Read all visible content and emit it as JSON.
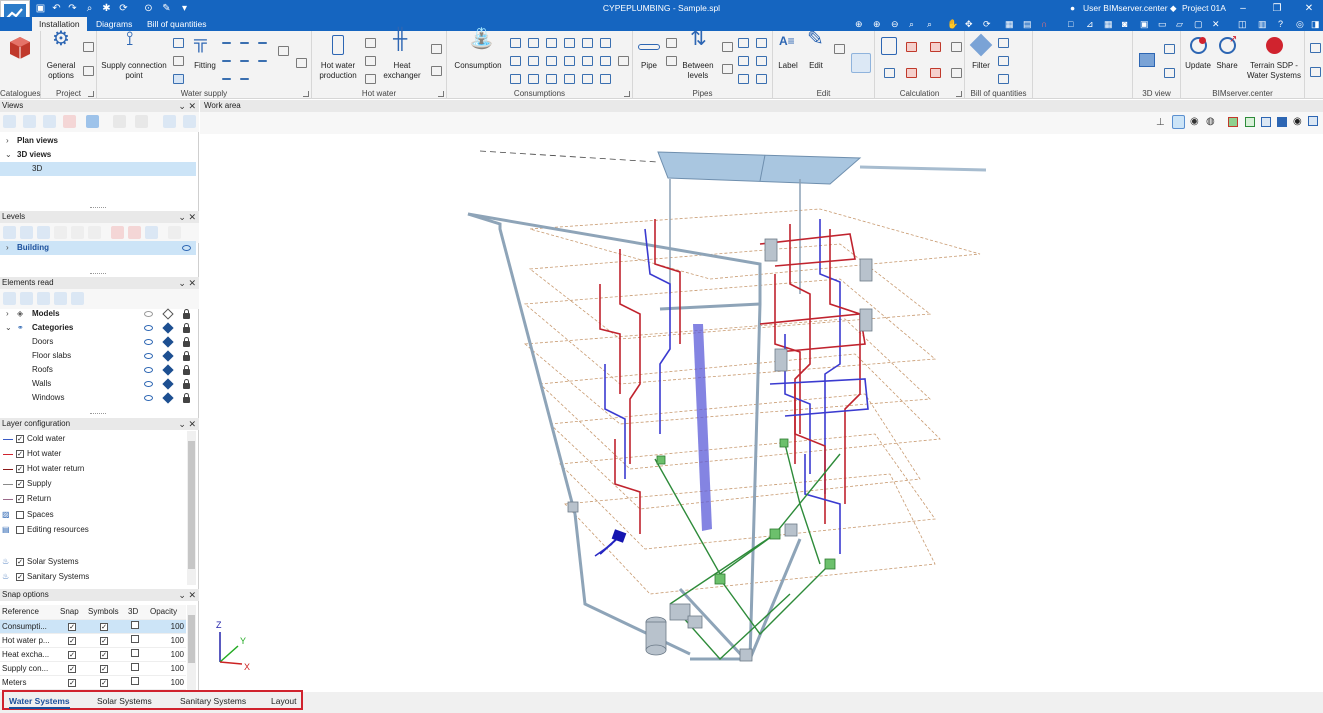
{
  "window": {
    "title": "CYPEPLUMBING - Sample.spl",
    "user": "User BIMserver.center",
    "project": "Project 01A"
  },
  "ribbon_tabs": [
    {
      "label": "Installation",
      "active": true
    },
    {
      "label": "Diagrams",
      "active": false
    },
    {
      "label": "Bill of quantities",
      "active": false
    }
  ],
  "ribbon": {
    "groups": {
      "catalogues": "Catalogues",
      "project": "Project",
      "water_supply": "Water supply",
      "hot_water": "Hot water",
      "consumptions": "Consumptions",
      "pipes": "Pipes",
      "edit": "Edit",
      "calculation": "Calculation",
      "bill_of_quantities": "Bill of quantities",
      "view3d": "3D view",
      "bimserver": "BIMserver.center"
    },
    "buttons": {
      "general_options": "General options",
      "supply_connection_point": "Supply connection point",
      "fitting": "Fitting",
      "hot_water_production": "Hot water production",
      "heat_exchanger": "Heat exchanger",
      "consumption": "Consumption",
      "pipe": "Pipe",
      "between_levels": "Between levels",
      "label": "Label",
      "edit": "Edit",
      "filter": "Filter",
      "update": "Update",
      "share": "Share",
      "terrain_sdp": "Terrain SDP - Water Systems"
    }
  },
  "panels": {
    "views": {
      "title": "Views",
      "items": [
        "Plan views",
        "3D views"
      ],
      "child": "3D"
    },
    "levels": {
      "title": "Levels",
      "item": "Building"
    },
    "elements": {
      "title": "Elements read",
      "models": "Models",
      "categories": "Categories",
      "children": [
        "Doors",
        "Floor slabs",
        "Roofs",
        "Walls",
        "Windows"
      ]
    },
    "layers": {
      "title": "Layer configuration",
      "items": [
        {
          "label": "Cold water",
          "color": "#3b5bc4"
        },
        {
          "label": "Hot water",
          "color": "#d0232e"
        },
        {
          "label": "Hot water return",
          "color": "#8b1a1a"
        },
        {
          "label": "Supply",
          "color": "#8a8a8a"
        },
        {
          "label": "Return",
          "color": "#9b6a8a"
        },
        {
          "label": "Spaces",
          "color": ""
        },
        {
          "label": "Editing resources",
          "color": ""
        }
      ],
      "systems": [
        "Solar Systems",
        "Sanitary Systems"
      ]
    },
    "snap": {
      "title": "Snap options",
      "headers": [
        "Reference",
        "Snap",
        "Symbols",
        "3D",
        "Opacity"
      ],
      "rows": [
        {
          "name": "Consumpti...",
          "snap": true,
          "symbols": true,
          "d3": false,
          "opacity": "100"
        },
        {
          "name": "Hot water p...",
          "snap": true,
          "symbols": true,
          "d3": false,
          "opacity": "100"
        },
        {
          "name": "Heat excha...",
          "snap": true,
          "symbols": true,
          "d3": false,
          "opacity": "100"
        },
        {
          "name": "Supply con...",
          "snap": true,
          "symbols": true,
          "d3": false,
          "opacity": "100"
        },
        {
          "name": "Meters",
          "snap": true,
          "symbols": true,
          "d3": false,
          "opacity": "100"
        }
      ]
    }
  },
  "work_area": {
    "title": "Work area",
    "axes": {
      "z": "Z",
      "y": "Y",
      "x": "X"
    }
  },
  "bottom_tabs": [
    {
      "label": "Water Systems",
      "active": true
    },
    {
      "label": "Solar Systems",
      "active": false
    },
    {
      "label": "Sanitary Systems",
      "active": false
    },
    {
      "label": "Layout",
      "active": false
    }
  ],
  "colors": {
    "accent": "#1565c0",
    "cold_water": "#3b5bc4",
    "hot_water": "#d0232e",
    "return_green": "#2e8b3a",
    "highlight_border": "#d0232e"
  }
}
